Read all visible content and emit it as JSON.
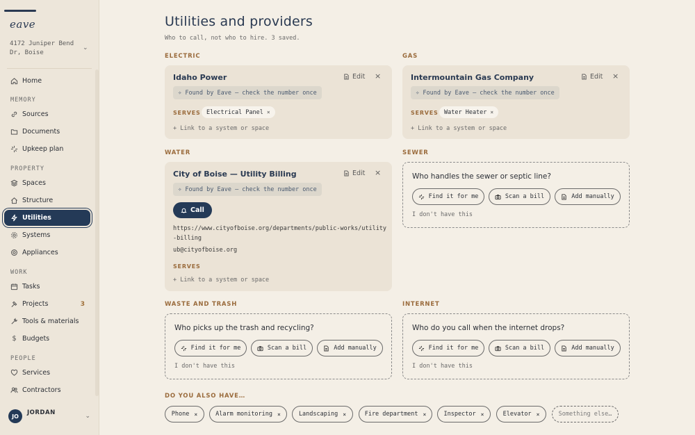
{
  "sidebar": {
    "logo": "eave",
    "address": "4172 Juniper Bend Dr, Boise",
    "sections": {
      "memory": "MEMORY",
      "property": "PROPERTY",
      "work": "WORK",
      "people": "PEOPLE"
    },
    "items": {
      "home": "Home",
      "sources": "Sources",
      "documents": "Documents",
      "upkeep": "Upkeep plan",
      "spaces": "Spaces",
      "structure": "Structure",
      "utilities": "Utilities",
      "systems": "Systems",
      "appliances": "Appliances",
      "tasks": "Tasks",
      "projects": "Projects",
      "projects_count": "3",
      "tools": "Tools & materials",
      "budgets": "Budgets",
      "services": "Services",
      "contractors": "Contractors"
    },
    "user": {
      "initials": "JO",
      "name": "JORDAN"
    }
  },
  "main": {
    "title": "Utilities and providers",
    "subtitle": "Who to call, not who to hire. 3 saved.",
    "common": {
      "edit": "Edit",
      "found": "Found by Eave — check the number once",
      "serves": "SERVES",
      "link": "+ Link to a system or space",
      "find": "Find it for me",
      "scan": "Scan a bill",
      "add": "Add manually",
      "dont_have": "I don't have this"
    },
    "electric": {
      "label": "ELECTRIC",
      "name": "Idaho Power",
      "serves": "Electrical Panel"
    },
    "gas": {
      "label": "GAS",
      "name": "Intermountain Gas Company",
      "serves": "Water Heater"
    },
    "water": {
      "label": "WATER",
      "name": "City of Boise — Utility Billing",
      "call": "Call",
      "url_line1": "https://www.cityofboise.org/departments/public-works/utility",
      "url_line2": "-billing",
      "email": "ub@cityofboise.org"
    },
    "sewer": {
      "label": "SEWER",
      "question": "Who handles the sewer or septic line?"
    },
    "waste": {
      "label": "WASTE AND TRASH",
      "question": "Who picks up the trash and recycling?"
    },
    "internet": {
      "label": "INTERNET",
      "question": "Who do you call when the internet drops?"
    },
    "also": {
      "label": "DO YOU ALSO HAVE…",
      "chips": [
        "Phone",
        "Alarm monitoring",
        "Landscaping",
        "Fire department",
        "Inspector",
        "Elevator"
      ],
      "other": "Something else…"
    }
  }
}
